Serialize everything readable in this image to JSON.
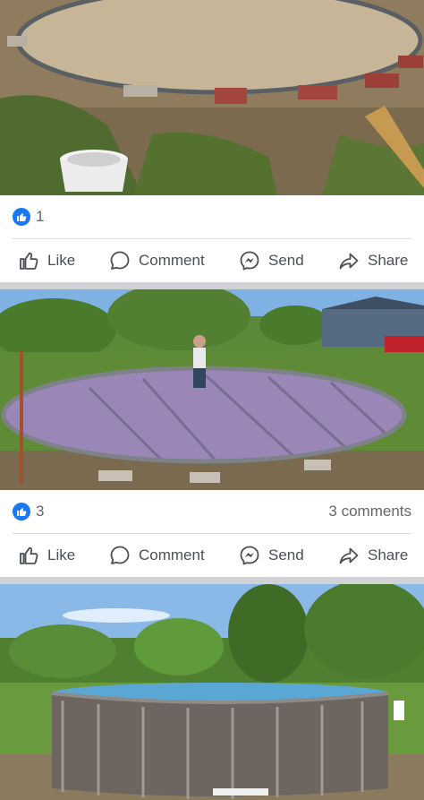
{
  "posts": [
    {
      "photo_icon": "pool-base-sand-ring-photo",
      "reaction_count": "1",
      "comments": "",
      "actions": {
        "like": "Like",
        "comment": "Comment",
        "send": "Send",
        "share": "Share"
      }
    },
    {
      "photo_icon": "pool-foam-insulation-photo",
      "reaction_count": "3",
      "comments": "3 comments",
      "actions": {
        "like": "Like",
        "comment": "Comment",
        "send": "Send",
        "share": "Share"
      }
    },
    {
      "photo_icon": "above-ground-pool-photo"
    }
  ],
  "colors": {
    "facebook_blue": "#1877f2",
    "action_text": "#4b4f56",
    "muted_text": "#65676b",
    "feed_background": "#d0d2d6"
  }
}
